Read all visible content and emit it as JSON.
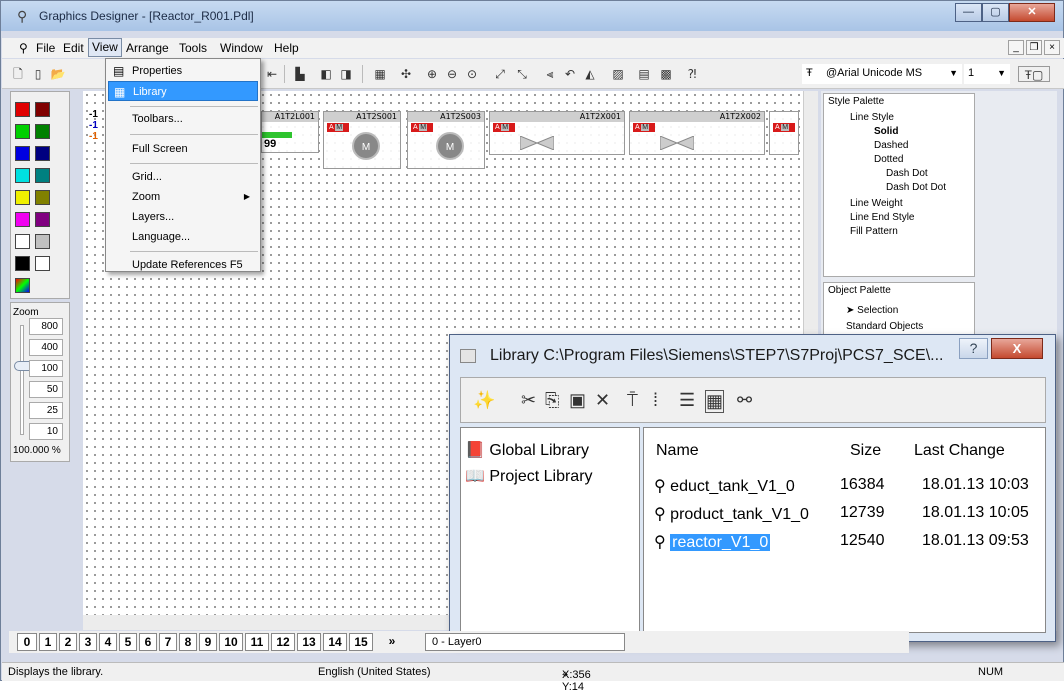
{
  "window": {
    "title": "Graphics Designer - [Reactor_R001.Pdl]"
  },
  "menubar": [
    "File",
    "Edit",
    "View",
    "Arrange",
    "Tools",
    "Window",
    "Help"
  ],
  "view_menu": {
    "items": [
      "Properties",
      "Library",
      "Toolbars...",
      "Full Screen",
      "Grid...",
      "Zoom",
      "Layers...",
      "Language...",
      "Update References F5"
    ],
    "highlighted": "Library"
  },
  "toolbar": {
    "font": "@Arial Unicode MS",
    "font_size": "1"
  },
  "zoom": {
    "label": "Zoom",
    "levels": [
      "800",
      "400",
      "100",
      "50",
      "25",
      "10"
    ],
    "current": "100.000 %"
  },
  "canvas_objects": [
    {
      "label": "A1T2L001",
      "value": "99"
    },
    {
      "label": "A1T2S001"
    },
    {
      "label": "A1T2S003"
    },
    {
      "label": "A1T2X001"
    },
    {
      "label": "A1T2X002"
    }
  ],
  "canvas_left_values": [
    "-1",
    "-1",
    "-1"
  ],
  "style_palette": {
    "title": "Style Palette",
    "items": [
      "Line Style",
      "Solid",
      "Dashed",
      "Dotted",
      "Dash Dot",
      "Dash Dot Dot",
      "Line Weight",
      "Line End Style",
      "Fill Pattern"
    ]
  },
  "object_palette": {
    "title": "Object Palette",
    "items": [
      "Selection",
      "Standard Objects"
    ]
  },
  "library": {
    "title": "Library  C:\\Program Files\\Siemens\\STEP7\\S7Proj\\PCS7_SCE\\...",
    "tree": [
      "Global Library",
      "Project Library"
    ],
    "columns": [
      "Name",
      "Size",
      "Last Change"
    ],
    "rows": [
      {
        "name": "educt_tank_V1_0",
        "size": "16384",
        "date": "18.01.13 10:03"
      },
      {
        "name": "product_tank_V1_0",
        "size": "12739",
        "date": "18.01.13 10:05"
      },
      {
        "name": "reactor_V1_0",
        "size": "12540",
        "date": "18.01.13 09:53"
      }
    ],
    "selected": "reactor_V1_0"
  },
  "layers": {
    "buttons": [
      "0",
      "1",
      "2",
      "3",
      "4",
      "5",
      "6",
      "7",
      "8",
      "9",
      "10",
      "11",
      "12",
      "13",
      "14",
      "15"
    ],
    "more": "»",
    "current": "0 - Layer0"
  },
  "status": {
    "hint": "Displays the library.",
    "language": "English (United States)",
    "coords": "X:356 Y:14",
    "num": "NUM"
  }
}
